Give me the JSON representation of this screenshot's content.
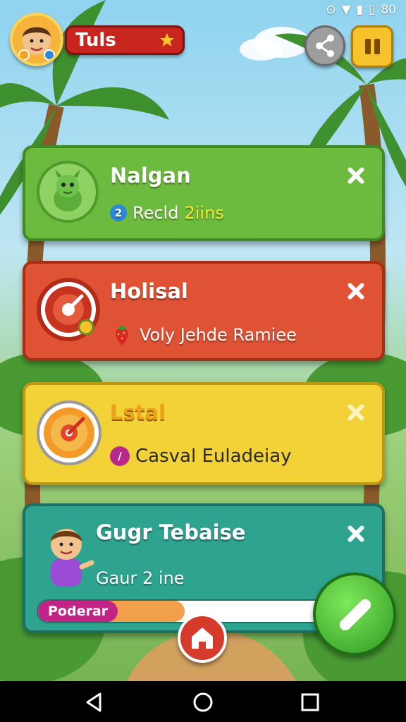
{
  "status_bar": {
    "time": "80"
  },
  "header": {
    "title": "Tuls"
  },
  "cards": [
    {
      "title": "Nalgan",
      "badge": "2",
      "subtitle": "Recld",
      "highlight": "2iins",
      "accent": "#6dbb3e"
    },
    {
      "title": "Holisal",
      "subtitle": "Voly Jehde Ramiee",
      "accent": "#df5234"
    },
    {
      "title": "Lstal",
      "badge": "/",
      "subtitle": "Casval Euladeiay",
      "accent": "#f3d237"
    },
    {
      "title": "Gugr Tebaise",
      "subtitle": "Gaur 2 ine",
      "progress_label": "Poderar",
      "progress": 0.5,
      "accent": "#2ea490"
    }
  ],
  "icons": {
    "share": "share-icon",
    "pause": "pause-icon",
    "close": "close-icon",
    "home": "home-icon",
    "edit": "pencil-icon",
    "back": "back-icon",
    "nav_home": "circle-home-icon",
    "recents": "square-recents-icon"
  }
}
